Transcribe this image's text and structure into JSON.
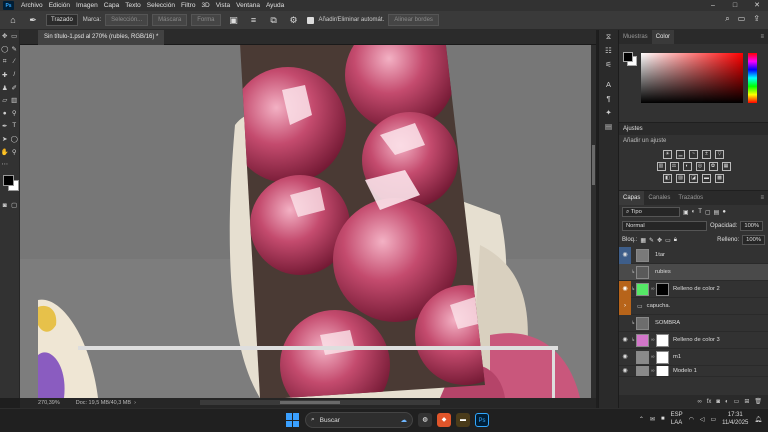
{
  "menubar": {
    "app_icon": "Ps",
    "items": [
      "Archivo",
      "Edición",
      "Imagen",
      "Capa",
      "Texto",
      "Selección",
      "Filtro",
      "3D",
      "Vista",
      "Ventana",
      "Ayuda"
    ]
  },
  "options": {
    "mode": "Trazado",
    "marca_label": "Marca:",
    "buttons": [
      "Selección...",
      "Máscara",
      "Forma"
    ],
    "auto_add_label": "Añadir/Eliminar automát.",
    "align_edges_label": "Alinear bordes"
  },
  "document": {
    "tab_title": "Sin título-1.psd al 270% (rubíes, RGB/16) *"
  },
  "status": {
    "zoom": "270,39%",
    "doc": "Doc: 19,5 MB/40,3 MB"
  },
  "panels": {
    "color_tabs": [
      "Muestras",
      "Color"
    ],
    "adjustments_title": "Ajustes",
    "adjustments_sub": "Añadir un ajuste",
    "layers_tabs": [
      "Capas",
      "Canales",
      "Trazados"
    ],
    "filter_kind": "Tipo",
    "blend_mode": "Normal",
    "opacity_label": "Opacidad:",
    "opacity_value": "100%",
    "lock_label": "Bloq.:",
    "fill_label": "Relleno:",
    "fill_value": "100%"
  },
  "layers": [
    {
      "name": "1tar",
      "eye": "blue"
    },
    {
      "name": "rubies",
      "eye": "none",
      "selected": true
    },
    {
      "name": "Relleno de color 2",
      "eye": "orange",
      "swatch": "#55e866",
      "mask": "#000000"
    },
    {
      "name": "capucha.",
      "eye": "orange",
      "folder": true
    },
    {
      "name": "SOMBRA",
      "eye": "none"
    },
    {
      "name": "Relleno de color 3",
      "eye": "none",
      "swatch": "#d276c9",
      "mask": "#ffffff"
    },
    {
      "name": "m1",
      "eye": "none",
      "mask": "#ffffff"
    },
    {
      "name": "Modelo 1",
      "eye": "none",
      "mask": "#ffffff"
    }
  ],
  "taskbar": {
    "search_placeholder": "Buscar",
    "lang_top": "ESP",
    "lang_bottom": "LAA",
    "time": "17:31",
    "date": "11/4/2025"
  },
  "colors": {
    "accent": "#31a8ff",
    "selection": "#4a4a4a"
  }
}
